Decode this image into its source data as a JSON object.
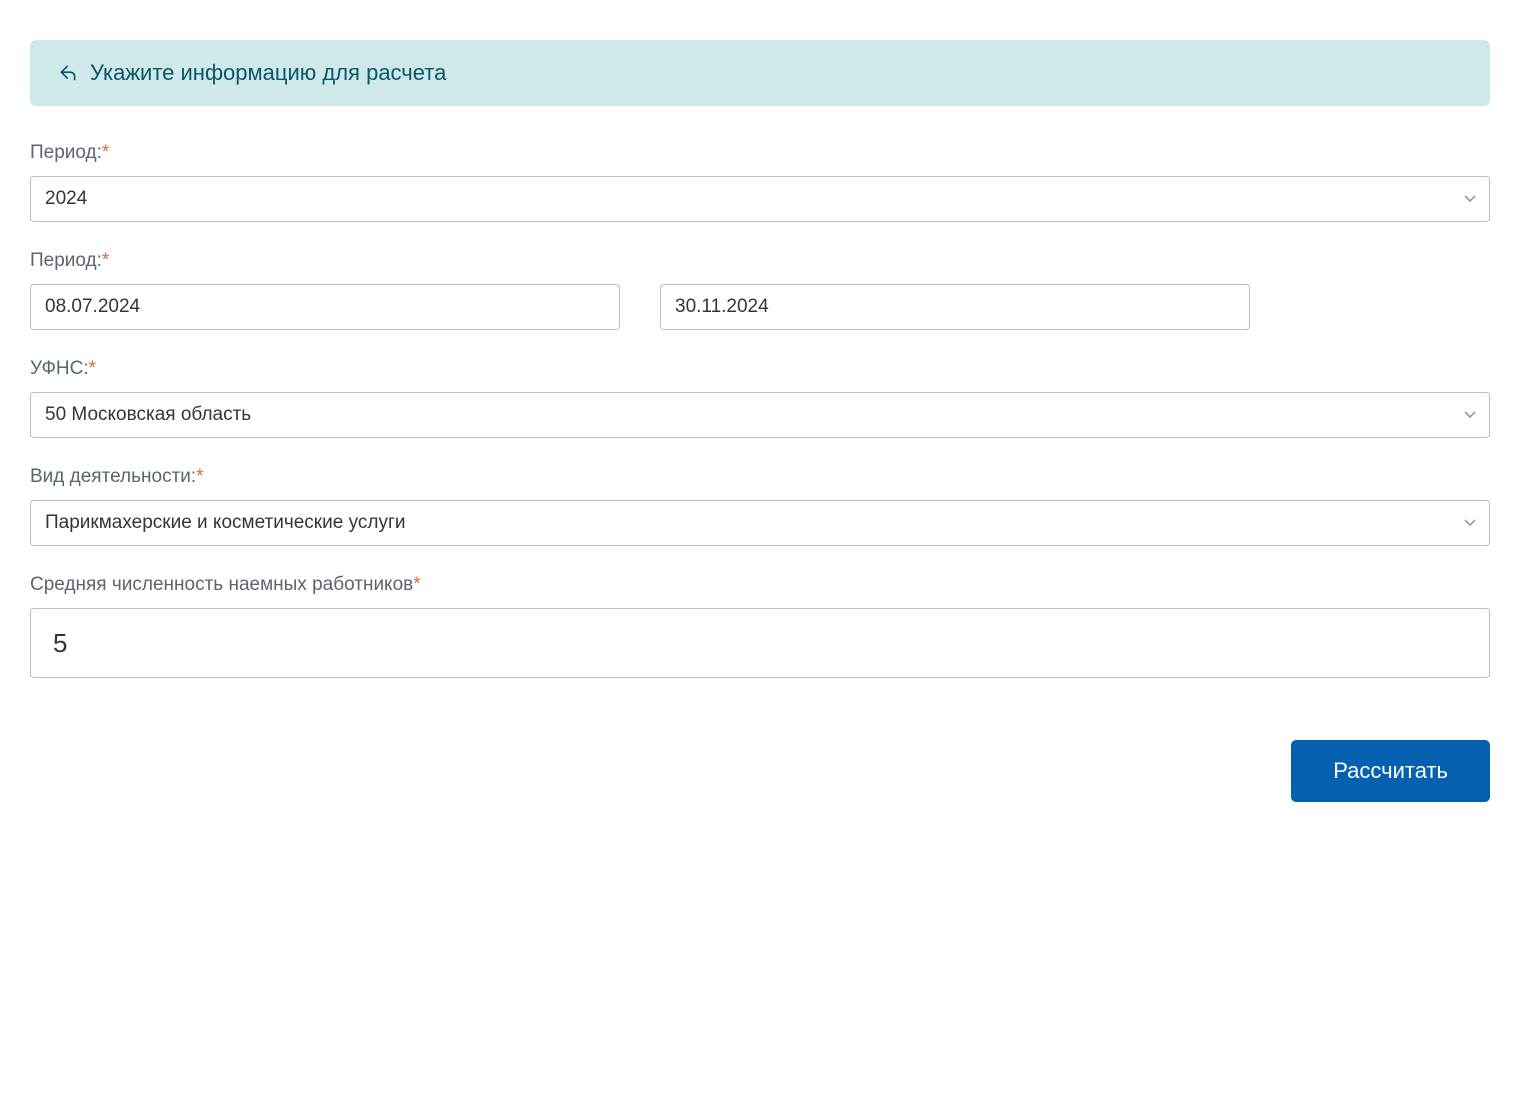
{
  "banner": {
    "text": "Укажите информацию для расчета"
  },
  "labels": {
    "period_year": "Период:",
    "period_dates": "Период:",
    "ufns": "УФНС:",
    "activity": "Вид деятельности:",
    "employees": "Средняя численность наемных работников",
    "required_mark": "*"
  },
  "values": {
    "year": "2024",
    "date_from": "08.07.2024",
    "date_to": "30.11.2024",
    "ufns": "50 Московская область",
    "activity": "Парикмахерские и косметические услуги",
    "employees": "5"
  },
  "buttons": {
    "calculate": "Рассчитать"
  }
}
